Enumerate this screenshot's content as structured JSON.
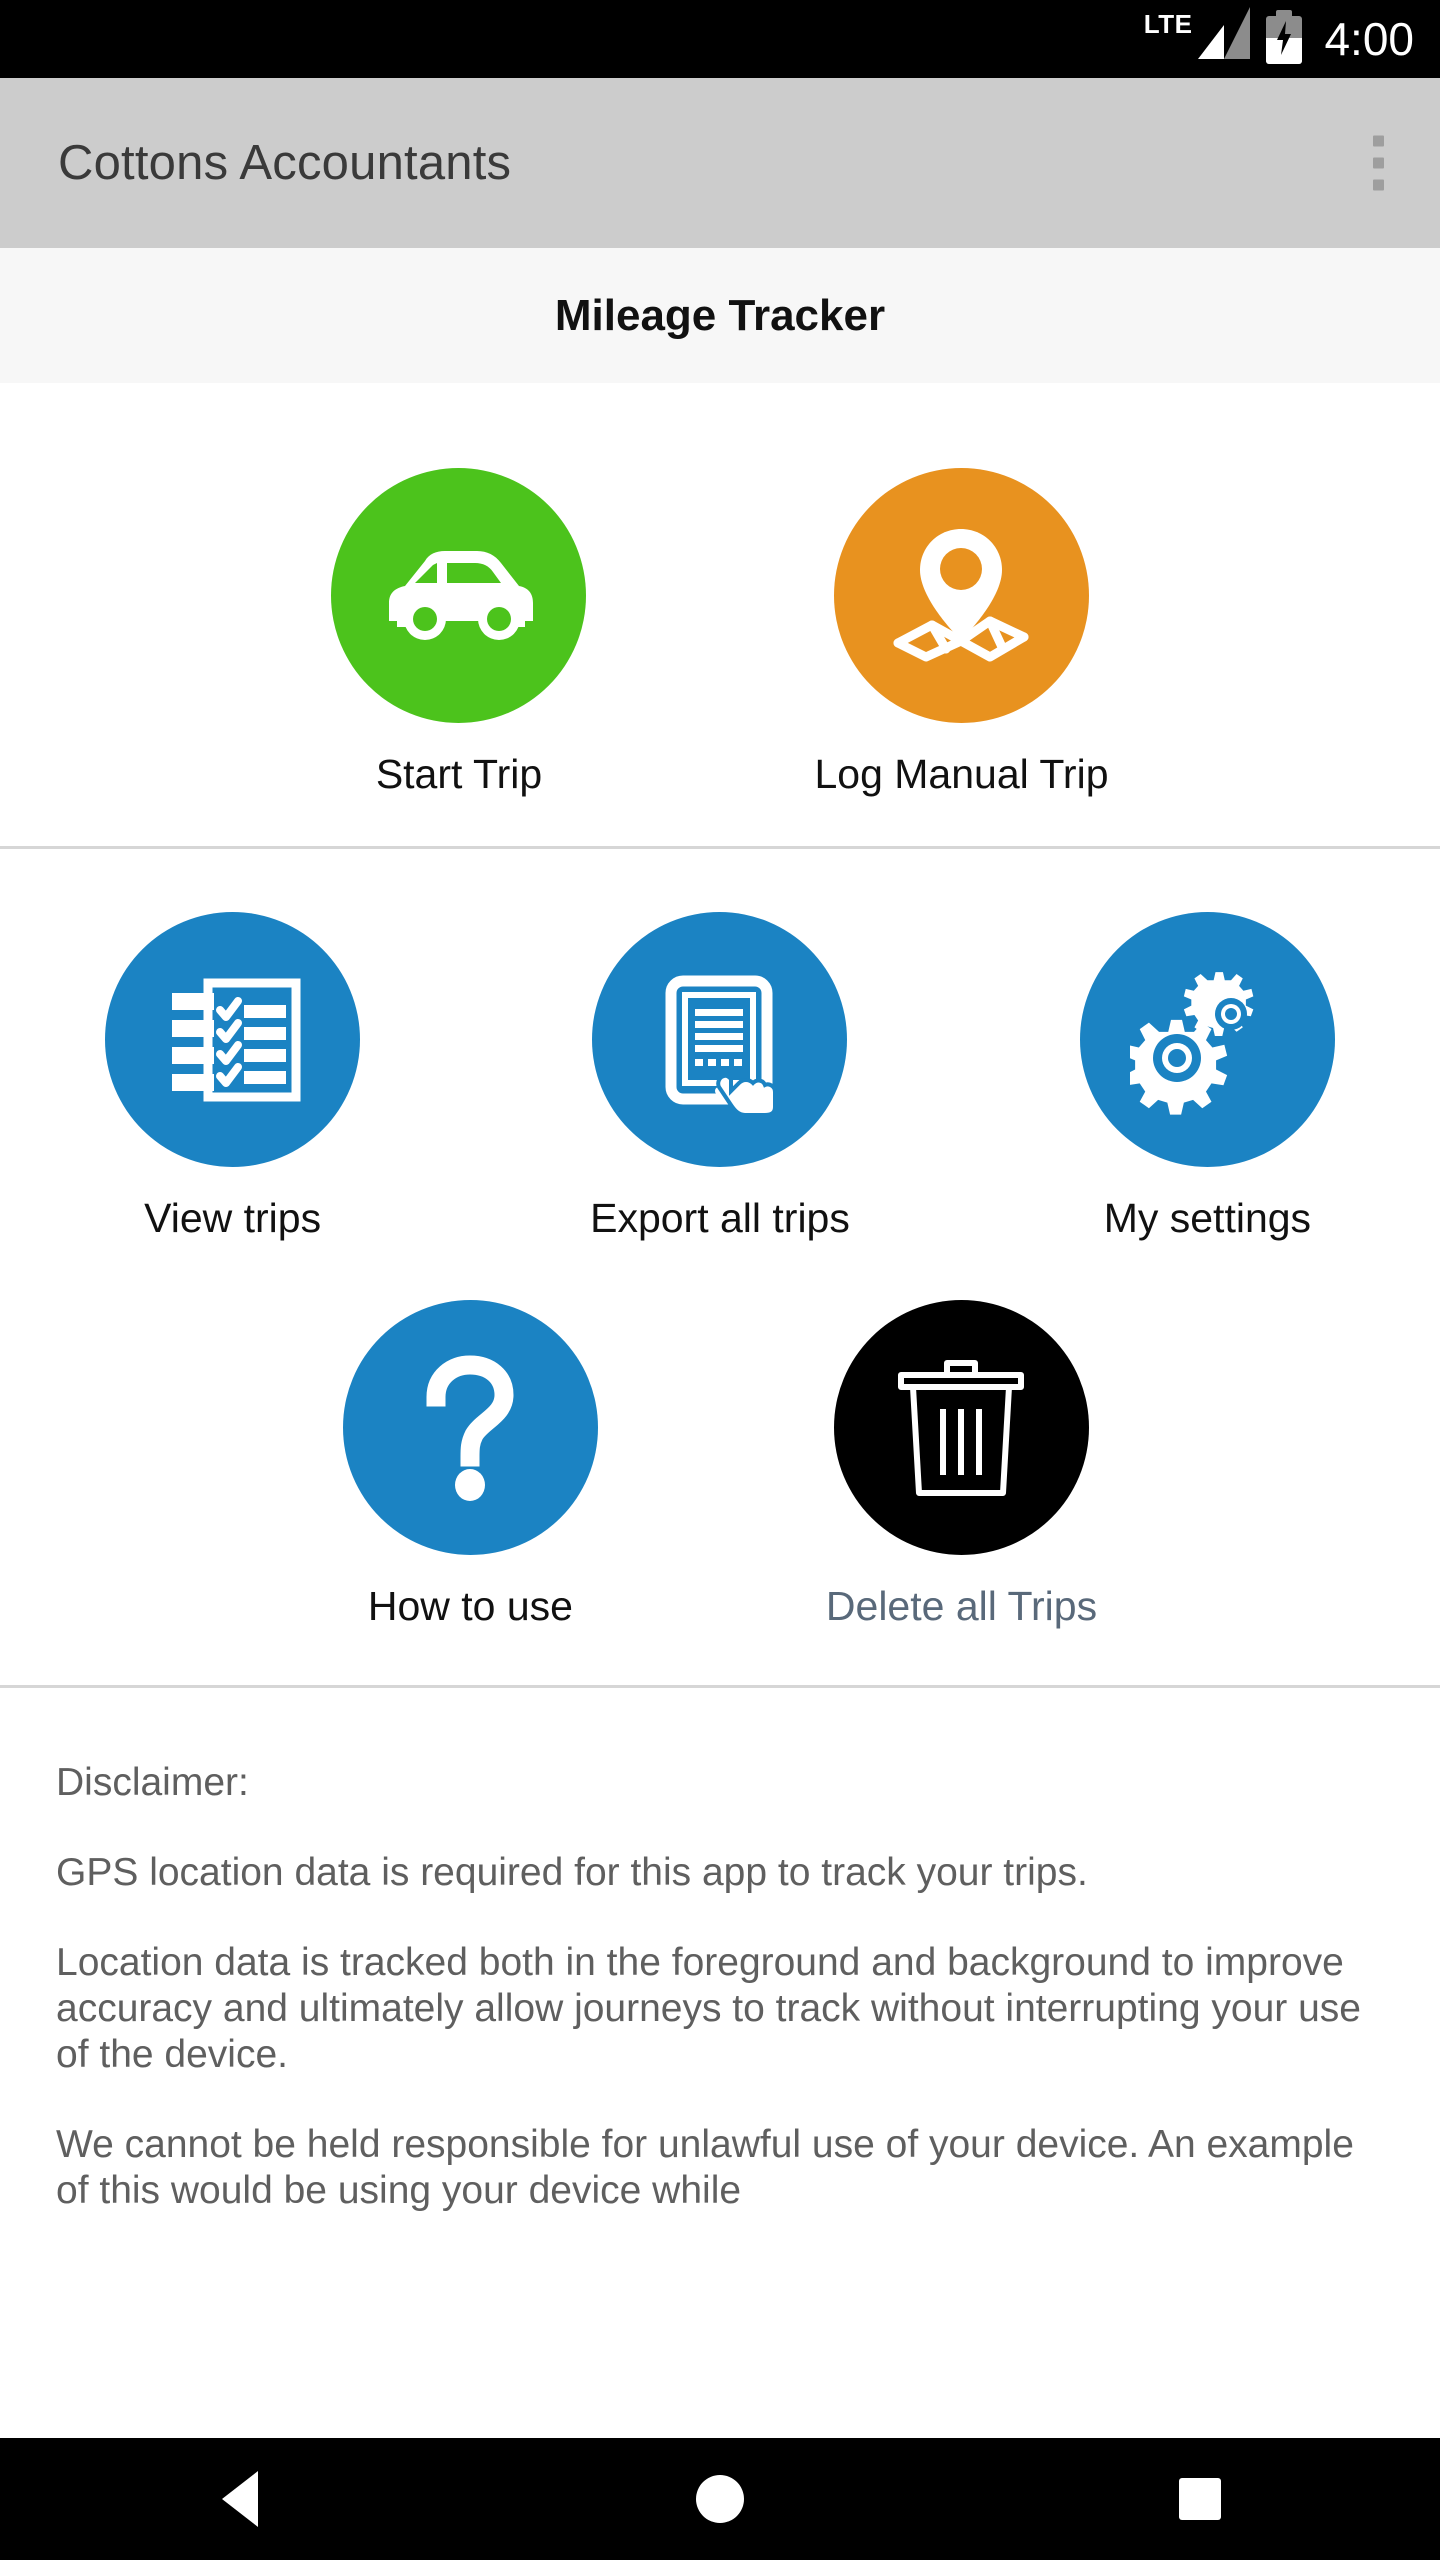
{
  "status_bar": {
    "network_label": "LTE",
    "time": "4:00",
    "signal_icon": "signal-bars-icon",
    "battery_icon": "battery-charging-icon"
  },
  "toolbar": {
    "title": "Cottons Accountants",
    "overflow_icon": "more-vert-icon"
  },
  "subheader": {
    "title": "Mileage Tracker"
  },
  "colors": {
    "green": "#4CC31C",
    "orange": "#E8921F",
    "blue": "#1B83C3",
    "black": "#000000",
    "toolbar_bg": "#CCCCCC",
    "subheader_bg": "#F7F7F7",
    "muted_label": "#59697A"
  },
  "primary_actions": [
    {
      "label": "Start Trip",
      "icon": "car-icon",
      "color": "#4CC31C"
    },
    {
      "label": "Log Manual Trip",
      "icon": "map-pin-icon",
      "color": "#E8921F"
    }
  ],
  "secondary_actions": [
    {
      "label": "View trips",
      "icon": "checklist-notepad-icon",
      "color": "#1B83C3"
    },
    {
      "label": "Export all trips",
      "icon": "tablet-tap-icon",
      "color": "#1B83C3"
    },
    {
      "label": "My settings",
      "icon": "gears-icon",
      "color": "#1B83C3"
    }
  ],
  "tertiary_actions": [
    {
      "label": "How to use",
      "icon": "question-mark-icon",
      "color": "#1B83C3"
    },
    {
      "label": "Delete all Trips",
      "icon": "trash-can-icon",
      "color": "#000000"
    }
  ],
  "disclaimer": {
    "heading": "Disclaimer:",
    "paragraphs": [
      "GPS location data is required for this app to track your trips.",
      "Location data is tracked both in the foreground and background to improve accuracy and ultimately allow journeys to track without interrupting your use of the device.",
      "We cannot be held responsible for unlawful use of your device. An example of this would be using your device while"
    ]
  },
  "nav_bar": {
    "back": "back-button",
    "home": "home-button",
    "recents": "recents-button"
  }
}
